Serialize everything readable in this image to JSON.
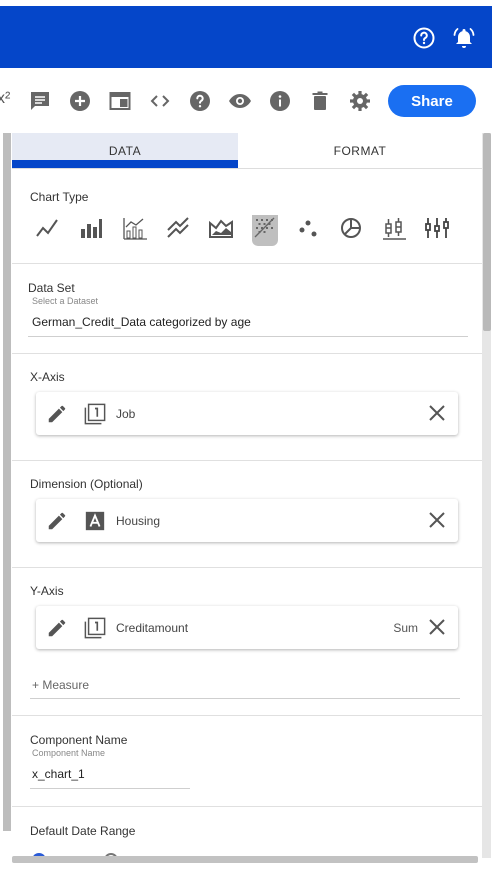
{
  "header": {
    "icons": [
      "help-circle-icon",
      "bell-alert-icon"
    ],
    "brand_color": "#0546c9"
  },
  "toolbar": {
    "partial_glyph": "x²",
    "icons": [
      "comment-icon",
      "add-circle-icon",
      "window-icon",
      "code-icon",
      "help-icon",
      "eye-icon",
      "info-icon",
      "trash-icon",
      "gear-icon"
    ],
    "share_label": "Share",
    "share_color": "#1a6ff2"
  },
  "tabs": [
    {
      "label": "DATA",
      "active": true
    },
    {
      "label": "FORMAT",
      "active": false
    }
  ],
  "chart_type": {
    "label": "Chart Type",
    "types": [
      "line-chart-icon",
      "bar-chart-icon",
      "combo-chart-icon",
      "multi-line-chart-icon",
      "area-chart-icon",
      "heatmap-icon",
      "scatter-chart-icon",
      "pie-chart-icon",
      "boxplot-icon",
      "candlestick-icon"
    ],
    "selected": "heatmap-icon"
  },
  "data_set": {
    "label": "Data Set",
    "hint": "Select a Dataset",
    "value": "German_Credit_Data categorized by age"
  },
  "x_axis": {
    "label": "X-Axis",
    "field": "Job",
    "type_icon": "numeric-icon"
  },
  "dimension": {
    "label": "Dimension (Optional)",
    "field": "Housing",
    "type_icon": "text-type-icon"
  },
  "y_axis": {
    "label": "Y-Axis",
    "field": "Creditamount",
    "aggregation": "Sum",
    "type_icon": "numeric-icon",
    "add_measure": "+ Measure"
  },
  "component": {
    "label": "Component Name",
    "hint": "Component Name",
    "value": "x_chart_1"
  },
  "date_range": {
    "label": "Default Date Range"
  }
}
